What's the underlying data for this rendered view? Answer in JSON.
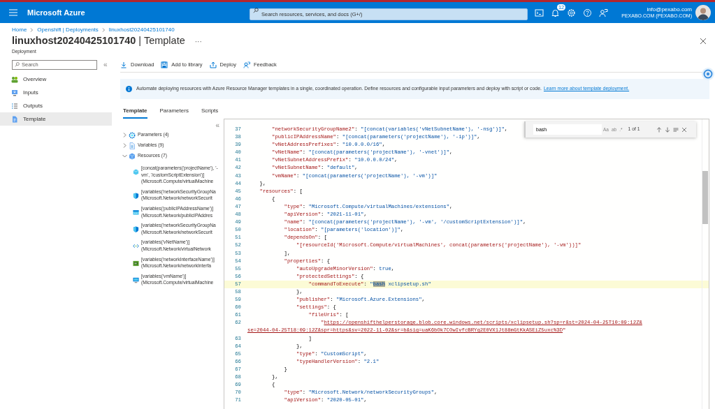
{
  "top_bar": {
    "brand": "Microsoft Azure",
    "search": {
      "placeholder": "Search resources, services, and docs (G+/)"
    },
    "notification_count": "12",
    "account": {
      "email": "info@pexabo.com",
      "directory": "PEXABO.COM (PEXABO.COM)"
    }
  },
  "breadcrumb": [
    "Home",
    "Openshift | Deployments",
    "linuxhost20240425101740"
  ],
  "page": {
    "title": "**linuxhost20240425101740** | Template",
    "more": "···",
    "subtitle": "Deployment"
  },
  "sidebar": {
    "search": {
      "placeholder": "Search"
    },
    "collapse": "«",
    "items": [
      {
        "label": "Overview",
        "selected": false
      },
      {
        "label": "Inputs",
        "selected": false
      },
      {
        "label": "Outputs",
        "selected": false
      },
      {
        "label": "Template",
        "selected": true
      }
    ]
  },
  "toolbar": [
    "Download",
    "Add to library",
    "Deploy",
    "Feedback"
  ],
  "info_banner": {
    "text": "Automate deploying resources with Azure Resource Manager templates in a single, coordinated operation. Define resources and configurable input parameters and deploy with script or code.",
    "link": "Learn more about template deployment."
  },
  "tabs": [
    {
      "label": "Template",
      "selected": true
    },
    {
      "label": "Parameters",
      "selected": false
    },
    {
      "label": "Scripts",
      "selected": false
    }
  ],
  "outline": {
    "collapse": "«",
    "nodes": [
      {
        "label": "Parameters (4)",
        "expanded": false
      },
      {
        "label": "Variables (9)",
        "expanded": false
      },
      {
        "label": "Resources (7)",
        "expanded": true,
        "children": [
          {
            "kind": "extension",
            "name": "[concat(parameters('projectName'), '-vm', '/customScriptExtension')]",
            "type": "(Microsoft.Compute/virtualMachine"
          },
          {
            "kind": "nsg",
            "name": "[variables('networkSecurityGroupNa",
            "type": "(Microsoft.Network/networkSecurit"
          },
          {
            "kind": "ip",
            "name": "[variables('publicIPAddressName')]",
            "type": "(Microsoft.Network/publicIPAddres"
          },
          {
            "kind": "nsg",
            "name": "[variables('networkSecurityGroupNa",
            "type": "(Microsoft.Network/networkSecurit"
          },
          {
            "kind": "vnet",
            "name": "[variables('vNetName')]",
            "type": "(Microsoft.Network/virtualNetwork"
          },
          {
            "kind": "nic",
            "name": "[variables('networkInterfaceName')]",
            "type": "(Microsoft.Network/networkInterfa"
          },
          {
            "kind": "vm",
            "name": "[variables('vmName')]",
            "type": "(Microsoft.Compute/virtualMachine"
          }
        ]
      }
    ]
  },
  "editor": {
    "find": {
      "value": "bash",
      "options": [
        "Aa",
        "ab",
        ".*"
      ],
      "result": "1 of 1"
    },
    "lines": [
      {
        "number": "37",
        "highlighted": false,
        "segments": [
          {
            "kind": "key",
            "text": "        \"networkSecurityGroupName2\""
          },
          {
            "kind": "punct",
            "text": ": "
          },
          {
            "kind": "value",
            "text": "\"[concat(variables('vNetSubnetName'), '-nsg')]\""
          },
          {
            "kind": "punct",
            "text": ","
          }
        ]
      },
      {
        "number": "38",
        "highlighted": false,
        "segments": [
          {
            "kind": "key",
            "text": "        \"publicIPAddressName\""
          },
          {
            "kind": "punct",
            "text": ": "
          },
          {
            "kind": "value",
            "text": "\"[concat(parameters('projectName'), '-ip')]\""
          },
          {
            "kind": "punct",
            "text": ","
          }
        ]
      },
      {
        "number": "39",
        "highlighted": false,
        "segments": [
          {
            "kind": "key",
            "text": "        \"vNetAddressPrefixes\""
          },
          {
            "kind": "punct",
            "text": ": "
          },
          {
            "kind": "value",
            "text": "\"10.0.0.0/16\""
          },
          {
            "kind": "punct",
            "text": ","
          }
        ]
      },
      {
        "number": "40",
        "highlighted": false,
        "segments": [
          {
            "kind": "key",
            "text": "        \"vNetName\""
          },
          {
            "kind": "punct",
            "text": ": "
          },
          {
            "kind": "value",
            "text": "\"[concat(parameters('projectName'), '-vnet')]\""
          },
          {
            "kind": "punct",
            "text": ","
          }
        ]
      },
      {
        "number": "41",
        "highlighted": false,
        "segments": [
          {
            "kind": "key",
            "text": "        \"vNetSubnetAddressPrefix\""
          },
          {
            "kind": "punct",
            "text": ": "
          },
          {
            "kind": "value",
            "text": "\"10.0.0.0/24\""
          },
          {
            "kind": "punct",
            "text": ","
          }
        ]
      },
      {
        "number": "42",
        "highlighted": false,
        "segments": [
          {
            "kind": "key",
            "text": "        \"vNetSubnetName\""
          },
          {
            "kind": "punct",
            "text": ": "
          },
          {
            "kind": "value",
            "text": "\"default\""
          },
          {
            "kind": "punct",
            "text": ","
          }
        ]
      },
      {
        "number": "43",
        "highlighted": false,
        "segments": [
          {
            "kind": "key",
            "text": "        \"vmName\""
          },
          {
            "kind": "punct",
            "text": ": "
          },
          {
            "kind": "value",
            "text": "\"[concat(parameters('projectName'), '-vm')]\""
          }
        ]
      },
      {
        "number": "44",
        "highlighted": false,
        "segments": [
          {
            "kind": "punct",
            "text": "    },"
          }
        ]
      },
      {
        "number": "45",
        "highlighted": false,
        "segments": [
          {
            "kind": "key",
            "text": "    \"resources\""
          },
          {
            "kind": "punct",
            "text": ": ["
          }
        ]
      },
      {
        "number": "46",
        "highlighted": false,
        "segments": [
          {
            "kind": "punct",
            "text": "        {"
          }
        ]
      },
      {
        "number": "47",
        "highlighted": false,
        "segments": [
          {
            "kind": "key",
            "text": "            \"type\""
          },
          {
            "kind": "punct",
            "text": ": "
          },
          {
            "kind": "value",
            "text": "\"Microsoft.Compute/virtualMachines/extensions\""
          },
          {
            "kind": "punct",
            "text": ","
          }
        ]
      },
      {
        "number": "48",
        "highlighted": false,
        "segments": [
          {
            "kind": "key",
            "text": "            \"apiVersion\""
          },
          {
            "kind": "punct",
            "text": ": "
          },
          {
            "kind": "value",
            "text": "\"2021-11-01\""
          },
          {
            "kind": "punct",
            "text": ","
          }
        ]
      },
      {
        "number": "49",
        "highlighted": false,
        "segments": [
          {
            "kind": "key",
            "text": "            \"name\""
          },
          {
            "kind": "punct",
            "text": ": "
          },
          {
            "kind": "value",
            "text": "\"[concat(parameters('projectName'), '-vm', '/customScriptExtension')]\""
          },
          {
            "kind": "punct",
            "text": ","
          }
        ]
      },
      {
        "number": "50",
        "highlighted": false,
        "segments": [
          {
            "kind": "key",
            "text": "            \"location\""
          },
          {
            "kind": "punct",
            "text": ": "
          },
          {
            "kind": "value",
            "text": "\"[parameters('location')]\""
          },
          {
            "kind": "punct",
            "text": ","
          }
        ]
      },
      {
        "number": "51",
        "highlighted": false,
        "segments": [
          {
            "kind": "key",
            "text": "            \"dependsOn\""
          },
          {
            "kind": "punct",
            "text": ": ["
          }
        ]
      },
      {
        "number": "52",
        "highlighted": false,
        "segments": [
          {
            "kind": "item",
            "text": "                \"[resourceId('Microsoft.Compute/virtualMachines', concat(parameters('projectName'), '-vm'))]\""
          }
        ]
      },
      {
        "number": "53",
        "highlighted": false,
        "segments": [
          {
            "kind": "punct",
            "text": "            ],"
          }
        ]
      },
      {
        "number": "54",
        "highlighted": false,
        "segments": [
          {
            "kind": "key",
            "text": "            \"properties\""
          },
          {
            "kind": "punct",
            "text": ": {"
          }
        ]
      },
      {
        "number": "55",
        "highlighted": false,
        "segments": [
          {
            "kind": "key",
            "text": "                \"autoUpgradeMinorVersion\""
          },
          {
            "kind": "punct",
            "text": ": "
          },
          {
            "kind": "keyword",
            "text": "true"
          },
          {
            "kind": "punct",
            "text": ","
          }
        ]
      },
      {
        "number": "56",
        "highlighted": false,
        "segments": [
          {
            "kind": "key",
            "text": "                \"protectedSettings\""
          },
          {
            "kind": "punct",
            "text": ": {"
          }
        ]
      },
      {
        "number": "57",
        "highlighted": true,
        "segments": [
          {
            "kind": "key",
            "text": "                    \"commandToExecute\""
          },
          {
            "kind": "punct",
            "text": ": "
          },
          {
            "kind": "value",
            "text": "\""
          },
          {
            "kind": "match",
            "text": "bash"
          },
          {
            "kind": "value",
            "text": " xclipsetup.sh\""
          }
        ]
      },
      {
        "number": "58",
        "highlighted": false,
        "segments": [
          {
            "kind": "punct",
            "text": "                },"
          }
        ]
      },
      {
        "number": "59",
        "highlighted": false,
        "segments": [
          {
            "kind": "key",
            "text": "                \"publisher\""
          },
          {
            "kind": "punct",
            "text": ": "
          },
          {
            "kind": "value",
            "text": "\"Microsoft.Azure.Extensions\""
          },
          {
            "kind": "punct",
            "text": ","
          }
        ]
      },
      {
        "number": "60",
        "highlighted": false,
        "segments": [
          {
            "kind": "key",
            "text": "                \"settings\""
          },
          {
            "kind": "punct",
            "text": ": {"
          }
        ]
      },
      {
        "number": "61",
        "highlighted": false,
        "segments": [
          {
            "kind": "key",
            "text": "                    \"fileUris\""
          },
          {
            "kind": "punct",
            "text": ": ["
          }
        ]
      },
      {
        "number": "62",
        "highlighted": false,
        "segments": [
          {
            "kind": "item",
            "text": "                        \""
          },
          {
            "kind": "link",
            "text": "https://openshifthelperstorage.blob.core.windows.net/scripts/xclipsetup.sh?sp=r&st=2024-04-25T10:09:12Z&"
          }
        ]
      },
      {
        "highlighted": false,
        "segments": [
          {
            "kind": "link",
            "text": "se=2044-04-25T18:09:12Z&spr=https&sv=2022-11-02&sr=b&sig=uaK6bOk7COwIvfcBRYg2E0VX1Jt88mGtKkASEiZ5uxc%3D"
          },
          {
            "kind": "item",
            "text": "\""
          }
        ]
      },
      {
        "number": "63",
        "highlighted": false,
        "segments": [
          {
            "kind": "punct",
            "text": "                    ]"
          }
        ]
      },
      {
        "number": "64",
        "highlighted": false,
        "segments": [
          {
            "kind": "punct",
            "text": "                },"
          }
        ]
      },
      {
        "number": "65",
        "highlighted": false,
        "segments": [
          {
            "kind": "key",
            "text": "                \"type\""
          },
          {
            "kind": "punct",
            "text": ": "
          },
          {
            "kind": "value",
            "text": "\"CustomScript\""
          },
          {
            "kind": "punct",
            "text": ","
          }
        ]
      },
      {
        "number": "66",
        "highlighted": false,
        "segments": [
          {
            "kind": "key",
            "text": "                \"typeHandlerVersion\""
          },
          {
            "kind": "punct",
            "text": ": "
          },
          {
            "kind": "value",
            "text": "\"2.1\""
          }
        ]
      },
      {
        "number": "67",
        "highlighted": false,
        "segments": [
          {
            "kind": "punct",
            "text": "            }"
          }
        ]
      },
      {
        "number": "68",
        "highlighted": false,
        "segments": [
          {
            "kind": "punct",
            "text": "        },"
          }
        ]
      },
      {
        "number": "69",
        "highlighted": false,
        "segments": [
          {
            "kind": "punct",
            "text": "        {"
          }
        ]
      },
      {
        "number": "70",
        "highlighted": false,
        "segments": [
          {
            "kind": "key",
            "text": "            \"type\""
          },
          {
            "kind": "punct",
            "text": ": "
          },
          {
            "kind": "value",
            "text": "\"Microsoft.Network/networkSecurityGroups\""
          },
          {
            "kind": "punct",
            "text": ","
          }
        ]
      },
      {
        "number": "71",
        "highlighted": false,
        "segments": [
          {
            "kind": "key",
            "text": "            \"apiVersion\""
          },
          {
            "kind": "punct",
            "text": ": "
          },
          {
            "kind": "value",
            "text": "\"2020-05-01\""
          },
          {
            "kind": "punct",
            "text": ","
          }
        ]
      }
    ]
  }
}
